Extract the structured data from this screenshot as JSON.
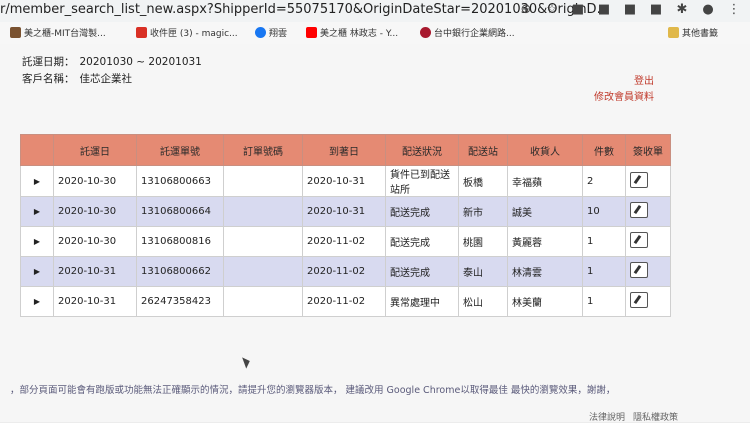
{
  "browser": {
    "url": "r/member_search_list_new.aspx?ShipperId=55075170&OriginDateStar=20201030&OriginD...",
    "bookmarks": [
      {
        "label": "美之櫃-MIT台灣製..."
      },
      {
        "label": "收件匣 (3) - magic..."
      },
      {
        "label": "翔雲"
      },
      {
        "label": "美之櫃 林政志 - Y..."
      },
      {
        "label": "台中銀行企業網路..."
      },
      {
        "label": "其他書籤"
      }
    ]
  },
  "page": {
    "date_range_label": "託運日期：",
    "date_range_value": "20201030 ~ 20201031",
    "customer_label": "客戶名稱：",
    "customer_value": "佳芯企業社",
    "logout_label": "登出",
    "edit_member_label": "修改會員資料"
  },
  "table": {
    "headers": [
      "託運日",
      "託運單號",
      "訂單號碼",
      "到著日",
      "配送狀況",
      "配送站",
      "收貨人",
      "件數",
      "簽收單"
    ],
    "rows": [
      {
        "date": "2020-10-30",
        "waybill": "13106800663",
        "order": "",
        "arrive": "2020-10-31",
        "status": "貨件已到配送站所",
        "station": "板橋",
        "receiver": "幸福蘋",
        "count": "2"
      },
      {
        "date": "2020-10-30",
        "waybill": "13106800664",
        "order": "",
        "arrive": "2020-10-31",
        "status": "配送完成",
        "station": "新市",
        "receiver": "誠美",
        "count": "10"
      },
      {
        "date": "2020-10-30",
        "waybill": "13106800816",
        "order": "",
        "arrive": "2020-11-02",
        "status": "配送完成",
        "station": "桃園",
        "receiver": "黃麗蓉",
        "count": "1"
      },
      {
        "date": "2020-10-31",
        "waybill": "13106800662",
        "order": "",
        "arrive": "2020-11-02",
        "status": "配送完成",
        "station": "泰山",
        "receiver": "林清雲",
        "count": "1"
      },
      {
        "date": "2020-10-31",
        "waybill": "26247358423",
        "order": "",
        "arrive": "2020-11-02",
        "status": "異常處理中",
        "station": "松山",
        "receiver": "林美蘭",
        "count": "1"
      }
    ]
  },
  "footer": {
    "notice": "，部分頁面可能會有跑版或功能無法正確顯示的情況，請提升您的瀏覽器版本， 建議改用 Google Chrome以取得最佳 最快的瀏覽效果，謝謝，",
    "legal": "法律說明",
    "privacy": "隱私權政策"
  }
}
